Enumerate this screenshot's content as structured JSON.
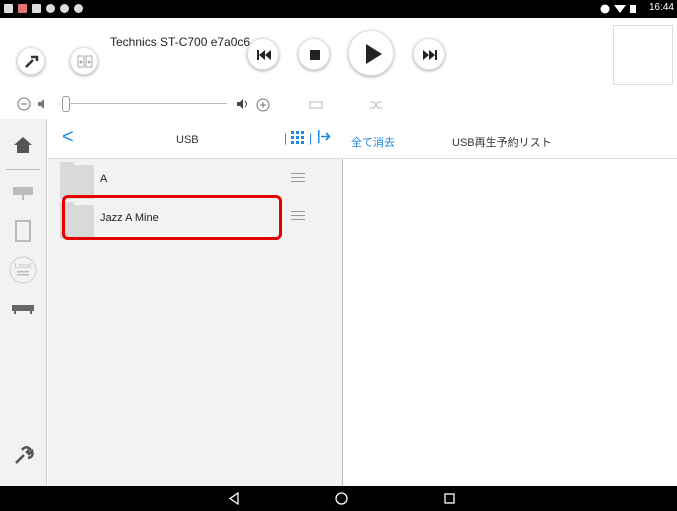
{
  "status_bar": {
    "clock": "16:44"
  },
  "player": {
    "device_name": "Technics ST-C700 e7a0c6",
    "icons": [
      "wrench-icon",
      "speaker-icon",
      "previous-icon",
      "stop-icon",
      "play-icon",
      "next-icon"
    ]
  },
  "controls": {
    "icons": [
      "volume-down-icon",
      "mute-icon",
      "volume-up-icon",
      "repeat-icon",
      "shuffle-icon"
    ]
  },
  "sidebar": {
    "items": [
      "home-icon",
      "network-player-icon",
      "tablet-icon",
      "local-icon",
      "usb-device-icon",
      "settings-wrench-icon"
    ],
    "local_label": "Local"
  },
  "left_pane": {
    "title": "USB",
    "back_glyph": "<",
    "rows": [
      {
        "label": "A"
      },
      {
        "label": "Jazz A Mine"
      }
    ]
  },
  "right_pane": {
    "clear_all": "全て消去",
    "title": "USB再生予約リスト"
  },
  "nav_bar": {
    "back": "◁",
    "home": "○",
    "recents": "□"
  },
  "colors": {
    "accent": "#1e88e5",
    "highlight": "#e60000",
    "pane_bg": "#f2f2f2"
  }
}
